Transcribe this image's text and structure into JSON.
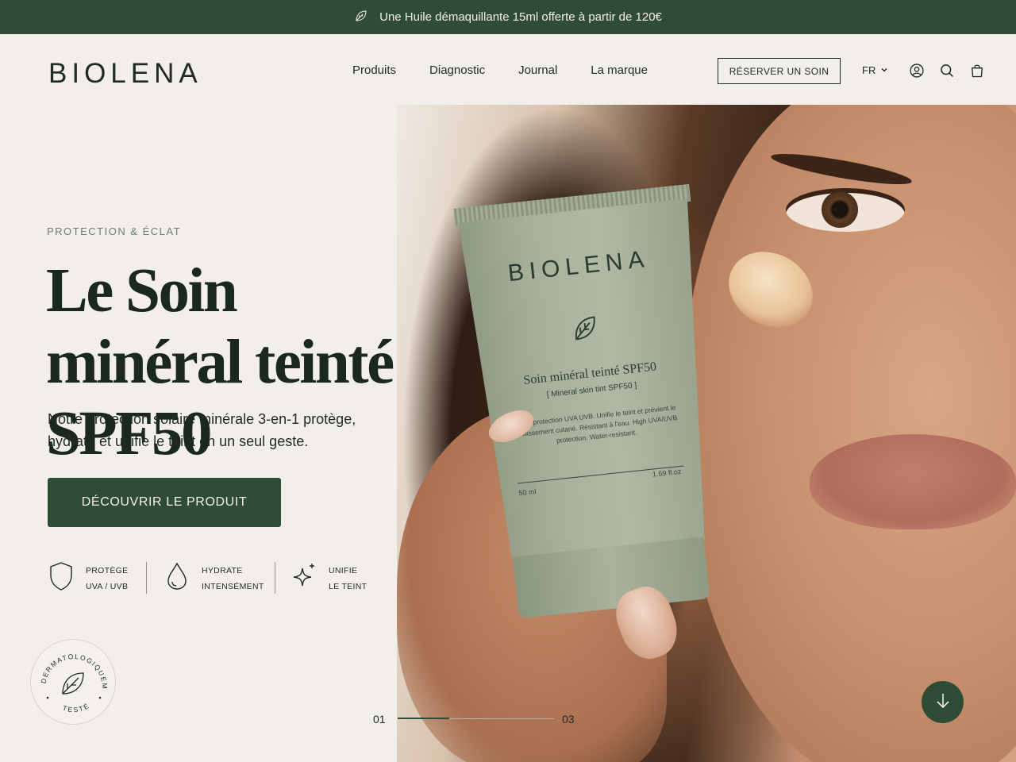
{
  "promo": {
    "text": "Une Huile démaquillante 15ml offerte à partir de 120€",
    "icon": "leaf-icon"
  },
  "header": {
    "logo": "BIOLENA",
    "nav": [
      "Produits",
      "Diagnostic",
      "Journal",
      "La marque"
    ],
    "book_button": "RÉSERVER UN SOIN",
    "language": "FR",
    "icons": [
      "account-icon",
      "search-icon",
      "bag-icon"
    ]
  },
  "hero": {
    "eyebrow": "PROTECTION & ÉCLAT",
    "headline": "Le Soin minéral teinté SPF50",
    "subline": "Notre protection solaire minérale 3-en-1 protège, hydrate et unifie le teint en un seul geste.",
    "cta": "DÉCOUVRIR LE PRODUIT"
  },
  "product": {
    "brand": "BIOLENA",
    "name": "Soin minéral teinté SPF50",
    "subname": "[ Mineral skin tint SPF50 ]",
    "description": "Haute protection UVA UVB. Unifie le teint et prévient le vieillissement cutané. Résistant à l'eau. High UVA/UVB protection. Water-resistant.",
    "volume": "50 ml",
    "volume_oz": "1.69 fl.oz"
  },
  "features": [
    {
      "line1": "PROTÈGE",
      "line2": "UVA / UVB",
      "icon": "shield-icon"
    },
    {
      "line1": "HYDRATE",
      "line2": "INTENSÉMENT",
      "icon": "drop-icon"
    },
    {
      "line1": "UNIFIE",
      "line2": "LE TEINT",
      "icon": "sparkle-icon"
    }
  ],
  "badge": {
    "top_text": "DERMATOLOGIQUEMENT",
    "bottom_text": "TESTÉ",
    "icon": "leaf-icon"
  },
  "slider": {
    "current": "01",
    "total": "03",
    "progress": 0.33
  },
  "colors": {
    "brand_green": "#2f4d36",
    "background": "#f2efea",
    "text": "#1e2a22"
  }
}
